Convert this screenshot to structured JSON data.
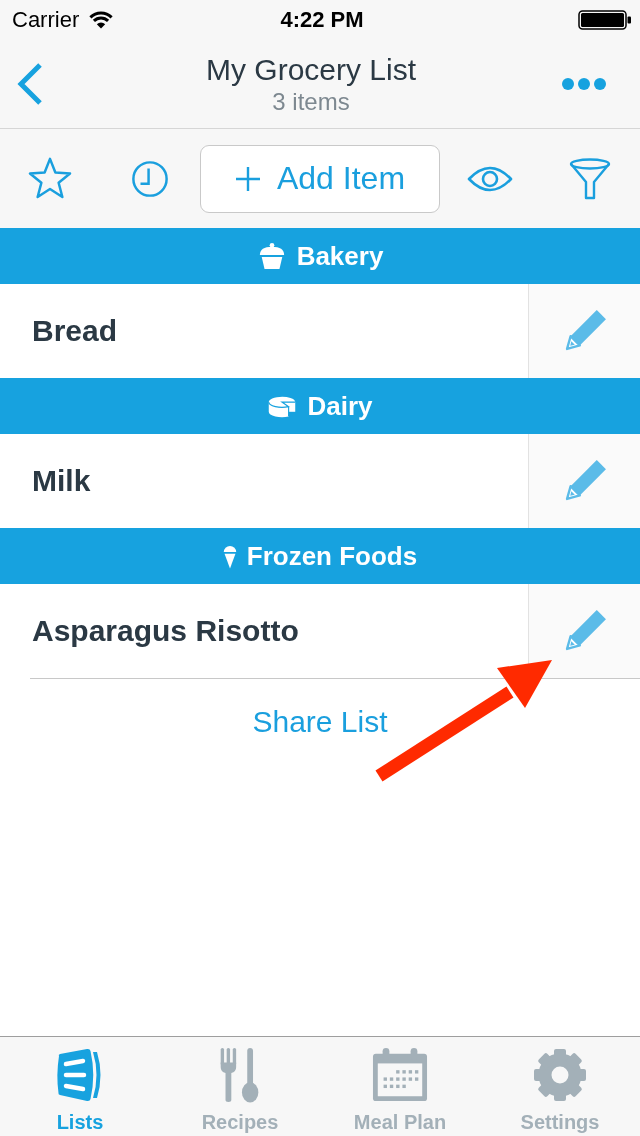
{
  "status_bar": {
    "carrier": "Carrier",
    "time": "4:22 PM"
  },
  "nav_bar": {
    "title": "My Grocery List",
    "subtitle": "3 items"
  },
  "toolbar": {
    "add_button": "Add Item"
  },
  "sections": [
    {
      "title": "Bakery",
      "kind": "bakery",
      "items": [
        {
          "name": "Bread"
        }
      ]
    },
    {
      "title": "Dairy",
      "kind": "dairy",
      "items": [
        {
          "name": "Milk"
        }
      ]
    },
    {
      "title": "Frozen Foods",
      "kind": "frozen",
      "items": [
        {
          "name": "Asparagus Risotto"
        }
      ]
    }
  ],
  "share_link": "Share List",
  "annotations": [
    {
      "kind": "arrow"
    }
  ],
  "tabs": [
    {
      "label": "Lists",
      "kind": "lists",
      "selected": true
    },
    {
      "label": "Recipes",
      "kind": "recipes",
      "selected": false
    },
    {
      "label": "Meal Plan",
      "kind": "meal_plan",
      "selected": false
    },
    {
      "label": "Settings",
      "kind": "settings",
      "selected": false
    }
  ]
}
